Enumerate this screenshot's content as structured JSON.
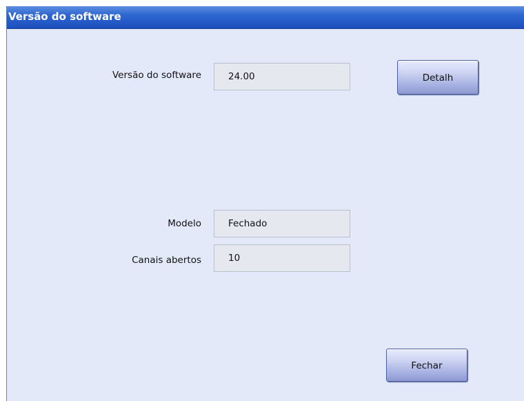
{
  "window": {
    "title": "Versão do software"
  },
  "fields": {
    "software_version": {
      "label": "Versão do software",
      "value": "24.00"
    },
    "model": {
      "label": "Modelo",
      "value": "Fechado"
    },
    "open_channels": {
      "label": "Canais abertos",
      "value": "10"
    }
  },
  "buttons": {
    "details": "Detalh",
    "close": "Fechar"
  }
}
